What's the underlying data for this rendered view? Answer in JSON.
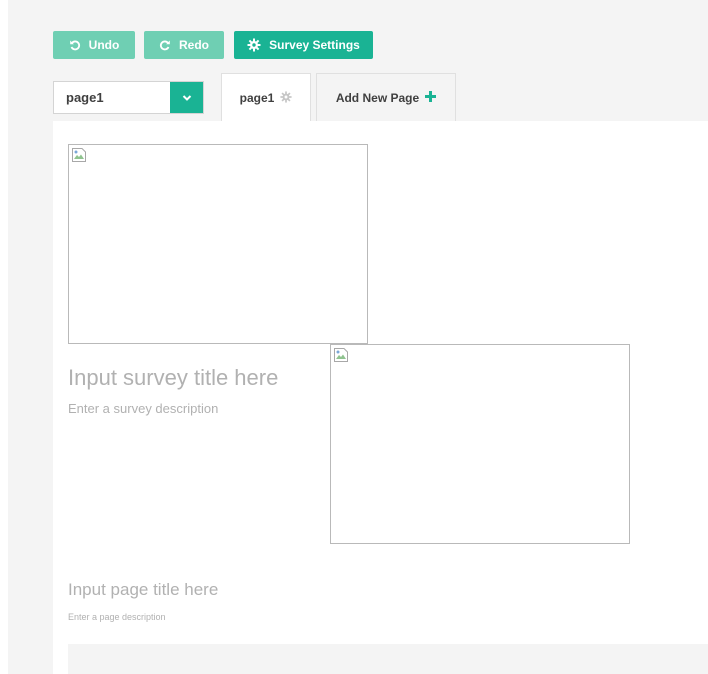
{
  "toolbar": {
    "undo_label": "Undo",
    "redo_label": "Redo",
    "settings_label": "Survey Settings"
  },
  "page_selector": {
    "selected": "page1"
  },
  "tabs": [
    {
      "label": "page1",
      "active": true
    },
    {
      "label": "Add New Page",
      "active": false
    }
  ],
  "survey": {
    "title_placeholder": "Input survey title here",
    "description_placeholder": "Enter a survey description"
  },
  "page": {
    "title_placeholder": "Input page title here",
    "description_placeholder": "Enter a page description"
  },
  "icons": {
    "undo": "undo-icon",
    "redo": "redo-icon",
    "settings": "gear-icon",
    "dropdown": "chevron-down-icon",
    "tab_settings": "gear-icon",
    "add_page": "plus-icon",
    "image": "broken-image-icon"
  },
  "colors": {
    "accent": "#1ab394",
    "accent_light": "#6fcfb3",
    "placeholder_text": "#b1b1b1",
    "canvas_bg": "#f4f4f4"
  }
}
